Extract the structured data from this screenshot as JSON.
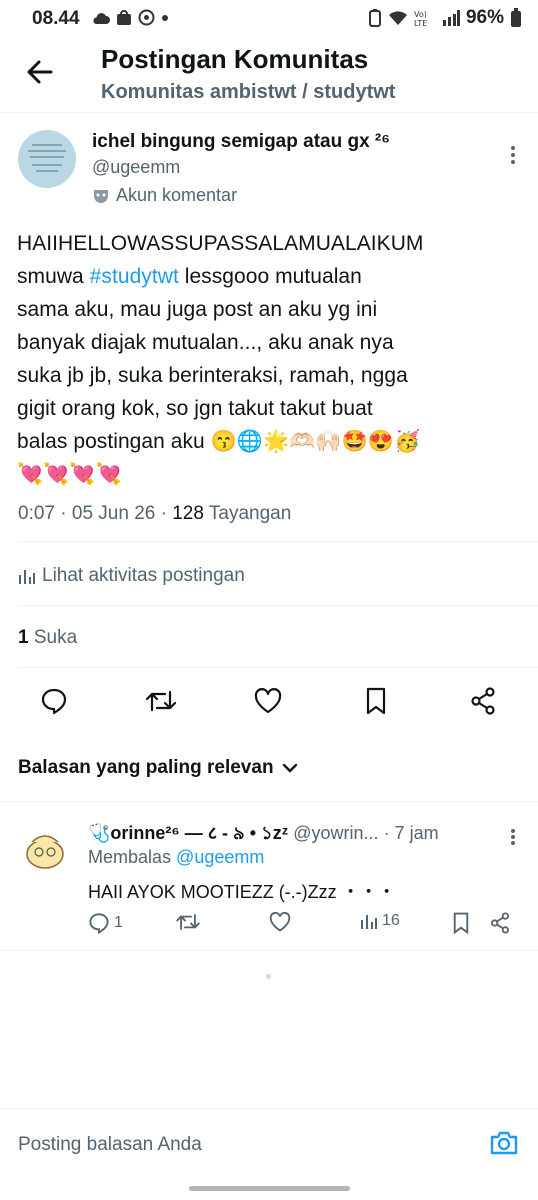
{
  "status_bar": {
    "time": "08.44",
    "battery": "96%",
    "network": "Vo) LTE"
  },
  "header": {
    "title": "Postingan Komunitas",
    "subtitle": "Komunitas ambistwt / studytwt"
  },
  "post": {
    "author_name": "ichel bingung semigap atau gx ²⁶",
    "handle": "@ugeemm",
    "account_label": "Akun komentar",
    "text_lines": [
      "HAIIHELLOWASSUPASSALAMUALAIKUM",
      "lessgooo mutualan",
      "sama aku, mau juga post an aku yg ini",
      "banyak diajak mutualan..., aku anak nya",
      "suka jb jb, suka berinteraksi, ramah, ngga",
      "gigit orang kok, so jgn takut takut buat",
      "balas postingan aku 😙🌐🌟🫶🏻🙌🏻🤩😍🥳",
      "💘💘💘💘"
    ],
    "text_line2_prefix": "smuwa",
    "hashtag": "#studytwt",
    "time": "0:07",
    "date": "05 Jun 26",
    "views_count": "128",
    "views_label": "Tayangan",
    "activity_label": "Lihat aktivitas postingan",
    "likes_count": "1",
    "likes_label": "Suka"
  },
  "replies_sort": "Balasan yang paling relevan",
  "reply": {
    "name": "🩺orinne²⁶ — ८ - ৯ • ১zᶻ",
    "handle": "@yowrin...",
    "time": "· 7 jam",
    "replying_prefix": "Membalas",
    "replying_to": "@ugeemm",
    "text": "HAII AYOK MOOTIEZZ (-.-)Zzz ・・・",
    "reply_count": "1",
    "view_count": "16"
  },
  "composer": {
    "placeholder": "Posting balasan Anda"
  },
  "icons": [
    "back-arrow-icon",
    "more-vertical-icon",
    "mask-icon",
    "chart-bars-icon",
    "reply-icon",
    "repost-icon",
    "heart-icon",
    "bookmark-icon",
    "share-icon",
    "chevron-down-icon",
    "camera-icon"
  ],
  "colors": {
    "accent": "#1d9bf0",
    "secondary_text": "#536471",
    "primary_text": "#0f1419"
  }
}
